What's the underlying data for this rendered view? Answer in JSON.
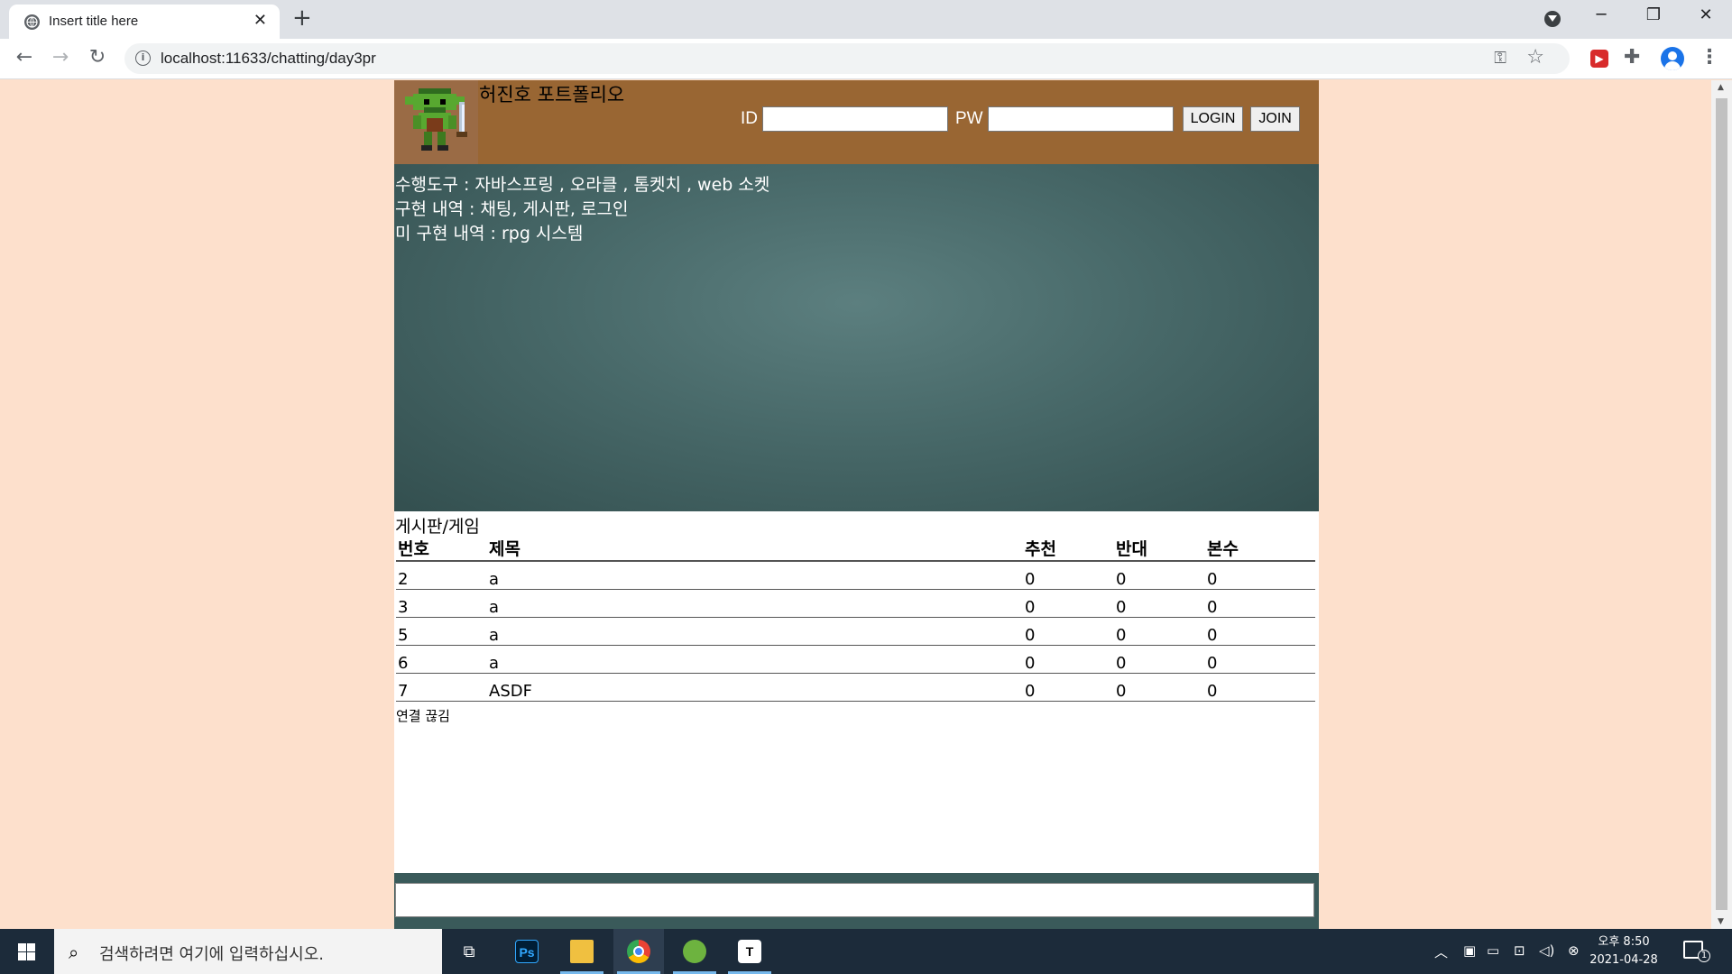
{
  "browser": {
    "tab_title": "Insert title here",
    "tab_close": "✕",
    "new_tab": "+",
    "url": "localhost:11633/chatting/day3pr",
    "window_controls": [
      "─",
      "❐",
      "✕"
    ]
  },
  "header": {
    "site_title": "허진호 포트폴리오",
    "id_label": "ID",
    "pw_label": "PW",
    "login_button": "LOGIN",
    "join_button": "JOIN"
  },
  "hero": {
    "lines": [
      "수행도구 : 자바스프링 , 오라클 , 톰켓치 , web 소켓",
      "구현 내역 : 채팅, 게시판, 로그인",
      "미 구현 내역 : rpg 시스템"
    ]
  },
  "board": {
    "title": "게시판/게임",
    "columns": [
      "번호",
      "제목",
      "추천",
      "반대",
      "본수"
    ],
    "rows": [
      [
        "2",
        "a",
        "0",
        "0",
        "0"
      ],
      [
        "3",
        "a",
        "0",
        "0",
        "0"
      ],
      [
        "5",
        "a",
        "0",
        "0",
        "0"
      ],
      [
        "6",
        "a",
        "0",
        "0",
        "0"
      ],
      [
        "7",
        "ASDF",
        "0",
        "0",
        "0"
      ]
    ],
    "status": "연결 끊김"
  },
  "chat": {
    "input_value": ""
  },
  "taskbar": {
    "search_placeholder": "검색하려면 여기에 입력하십시오.",
    "apps": [
      "task-view",
      "photoshop",
      "file-explorer",
      "chrome",
      "spring-tool-suite",
      "typora"
    ],
    "photoshop_label": "Ps",
    "typora_label": "T",
    "time": "오후 8:50",
    "date": "2021-04-28",
    "notification_count": "1"
  },
  "colors": {
    "page_bg": "#fde0cc",
    "header_bg": "#996633",
    "hero_bg": "#486969",
    "taskbar_bg": "#1c2b3a"
  }
}
